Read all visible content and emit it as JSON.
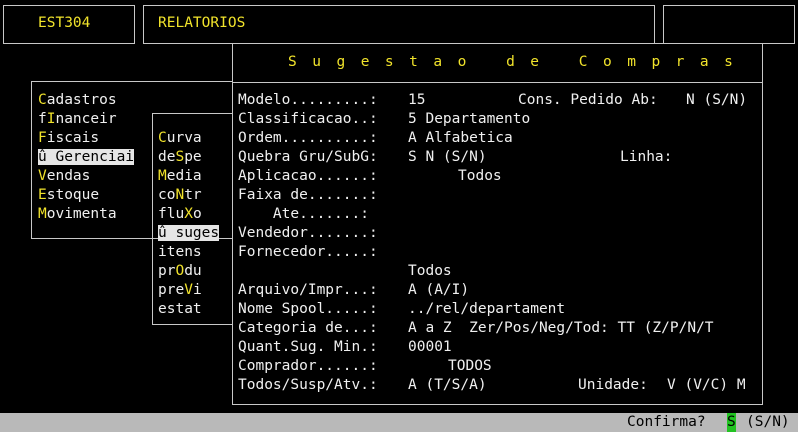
{
  "header": {
    "module_code": "EST304",
    "section_title": "RELATORIOS"
  },
  "menu_main": {
    "items": [
      {
        "hot": "C",
        "rest": "adastros"
      },
      {
        "pre": "f",
        "hot": "I",
        "rest": "nanceir"
      },
      {
        "hot": "F",
        "rest": "iscais"
      },
      {
        "selected": true,
        "text": "û Gerenciai"
      },
      {
        "hot": "V",
        "rest": "endas"
      },
      {
        "hot": "E",
        "rest": "stoque"
      },
      {
        "hot": "M",
        "rest": "ovimenta"
      }
    ]
  },
  "menu_sub": {
    "items": [
      {
        "hot": "C",
        "rest": "urva"
      },
      {
        "pre": "de",
        "hot": "S",
        "rest": "pe"
      },
      {
        "hot": "M",
        "rest": "edia"
      },
      {
        "pre": "co",
        "hot": "N",
        "rest": "tr"
      },
      {
        "pre": "flu",
        "hot": "X",
        "rest": "o"
      },
      {
        "selected": true,
        "text": "û suges"
      },
      {
        "text": "itens"
      },
      {
        "pre": "pr",
        "hot": "O",
        "rest": "du"
      },
      {
        "pre": "pre",
        "hot": "V",
        "rest": "i"
      },
      {
        "text": "estat"
      }
    ]
  },
  "dialog": {
    "title": "Sugestao de Compras",
    "fields": {
      "modelo": {
        "label": "Modelo.........:",
        "value": "15"
      },
      "cons_pedido": {
        "label": "Cons. Pedido Ab:",
        "value": "N (S/N)"
      },
      "classificacao": {
        "label": "Classificacao..:",
        "value": "5 Departamento"
      },
      "ordem": {
        "label": "Ordem..........:",
        "value": "A Alfabetica"
      },
      "quebra": {
        "label": "Quebra Gru/SubG:",
        "value": "S N (S/N)"
      },
      "linha": {
        "label": "Linha:",
        "value": ""
      },
      "aplicacao": {
        "label": "Aplicacao......:",
        "value": "Todos"
      },
      "faixa_de": {
        "label": "Faixa de.......:",
        "value": ""
      },
      "ate": {
        "label": "    Ate.......:",
        "value": ""
      },
      "vendedor": {
        "label": "Vendedor.......:",
        "value": ""
      },
      "fornecedor": {
        "label": "Fornecedor.....:",
        "value": "Todos"
      },
      "arquivo": {
        "label": "Arquivo/Impr...:",
        "value": "A (A/I)"
      },
      "nome_spool": {
        "label": "Nome Spool.....:",
        "value": "../rel/departament"
      },
      "categoria": {
        "label": "Categoria de...:",
        "value": "A a Z  Zer/Pos/Neg/Tod: TT (Z/P/N/T"
      },
      "quant_sug": {
        "label": "Quant.Sug. Min.:",
        "value": "00001"
      },
      "comprador": {
        "label": "Comprador......:",
        "value": "TODOS"
      },
      "todos_susp": {
        "label": "Todos/Susp/Atv.:",
        "value": "A (T/S/A)"
      },
      "unidade": {
        "label": "Unidade:",
        "value": "V (V/C) M"
      }
    }
  },
  "status_bar": {
    "prompt": "Confirma?",
    "answer": "S",
    "options": "(S/N)"
  },
  "colors": {
    "background": "#000000",
    "highlight": "#f1e32b",
    "text": "#f0f0f0",
    "cursor": "#22c322",
    "status_bar": "#b9b9b9"
  }
}
